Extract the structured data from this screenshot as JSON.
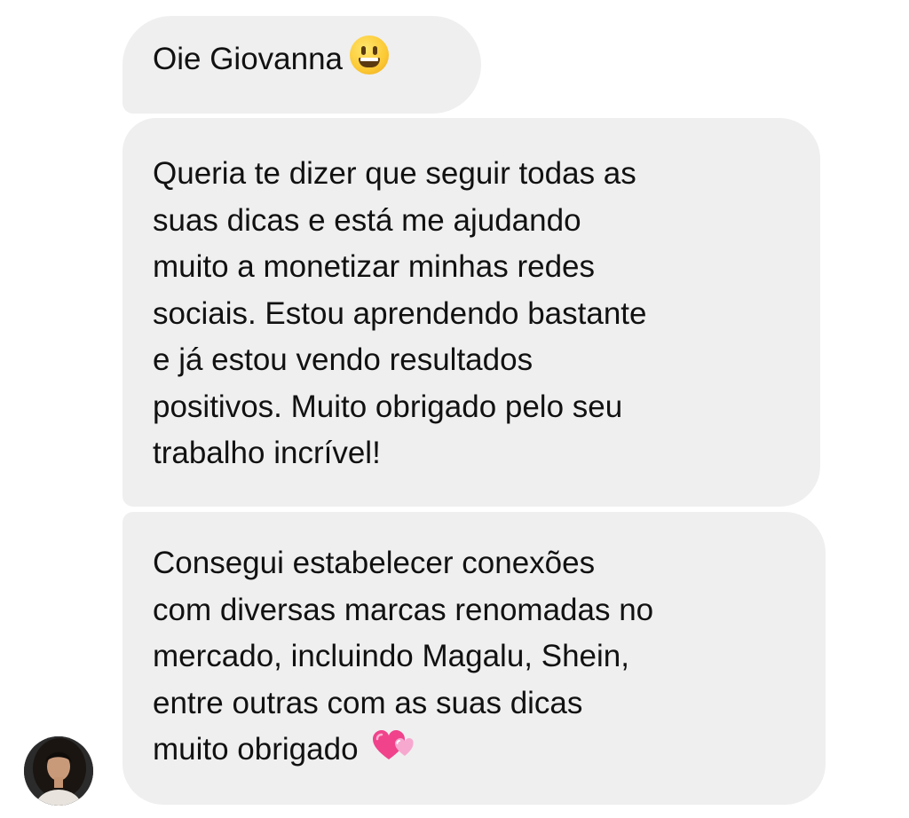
{
  "conversation": {
    "messages": [
      {
        "lines": [
          "Oie Giovanna"
        ],
        "emoji": "grinning-face-emoji"
      },
      {
        "lines": [
          "Queria te dizer que seguir todas as",
          "suas dicas e está me ajudando",
          "muito a monetizar minhas redes",
          "sociais. Estou aprendendo bastante",
          "e já estou vendo resultados",
          "positivos. Muito obrigado pelo seu",
          "trabalho incrível!"
        ]
      },
      {
        "lines": [
          "Consegui estabelecer conexões",
          "com diversas marcas renomadas no",
          "mercado, incluindo Magalu, Shein,",
          "entre outras com as suas dicas",
          "muito obrigado"
        ],
        "emoji": "two-hearts-emoji"
      }
    ]
  },
  "colors": {
    "bubble_background": "#efefef",
    "text": "#111111",
    "page_background": "#ffffff"
  }
}
